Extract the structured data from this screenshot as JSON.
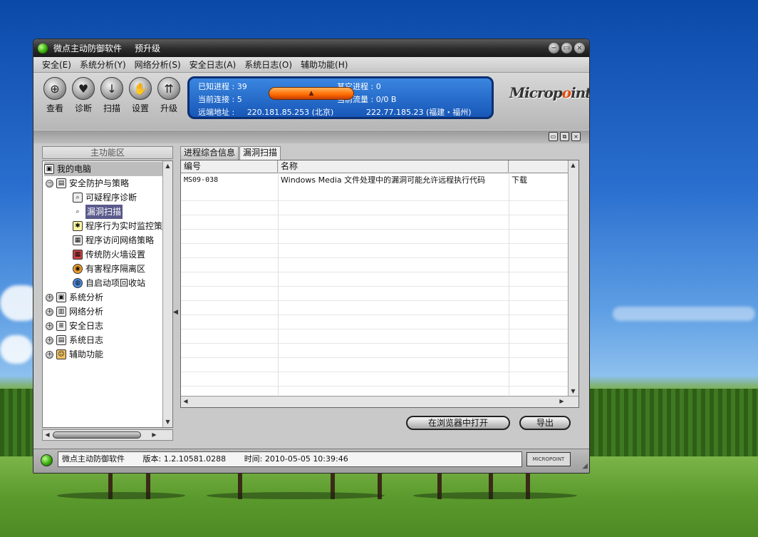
{
  "window": {
    "title": "微点主动防御软件",
    "upgrade": "预升级",
    "buttons": {
      "minimize": "−",
      "restore": "▭",
      "close": "×"
    }
  },
  "menu": [
    "安全(E)",
    "系统分析(Y)",
    "网络分析(S)",
    "安全日志(A)",
    "系统日志(O)",
    "辅助功能(H)"
  ],
  "toolbar": {
    "tools": [
      {
        "label": "查看",
        "icon": "magnifier-icon"
      },
      {
        "label": "诊断",
        "icon": "heart-diagnose-icon"
      },
      {
        "label": "扫描",
        "icon": "scan-icon"
      },
      {
        "label": "设置",
        "icon": "hand-settings-icon"
      },
      {
        "label": "升级",
        "icon": "upgrade-icon"
      }
    ]
  },
  "info": {
    "known_proc_label": "已知进程",
    "known_proc_value": "39",
    "other_proc_label": "其它进程",
    "other_proc_value": "0",
    "conn_label": "当前连接",
    "conn_value": "5",
    "traffic_label": "当前流量",
    "traffic_value": "0/0 B",
    "remote_label": "远端地址",
    "remote_ip1": "220.181.85.253 (北京)",
    "remote_ip2": "222.77.185.23 (福建・福州)"
  },
  "logo": {
    "text_a": "Microp",
    "text_o": "o",
    "text_b": "int"
  },
  "left_pane": {
    "title": "主功能区",
    "root": "我的电脑",
    "group": "安全防护与策略",
    "children": [
      "可疑程序诊断",
      "漏洞扫描",
      "程序行为实时监控策",
      "程序访问网络策略",
      "传统防火墙设置",
      "有害程序隔离区",
      "自启动项回收站"
    ],
    "collapsed": [
      "系统分析",
      "网络分析",
      "安全日志",
      "系统日志",
      "辅助功能"
    ]
  },
  "tabs": [
    "进程综合信息",
    "漏洞扫描"
  ],
  "grid": {
    "columns": [
      "编号",
      "名称",
      ""
    ],
    "rows": [
      {
        "id": "MS09-038",
        "name": "Windows Media 文件处理中的漏洞可能允许远程执行代码",
        "action": "下载"
      }
    ]
  },
  "actions": {
    "open_browser": "在浏览器中打开",
    "export": "导出"
  },
  "status": {
    "app": "微点主动防御软件",
    "version": "版本: 1.2.10581.0288",
    "time": "时间: 2010-05-05 10:39:46",
    "logo": "MICROPOINT"
  },
  "colors": {
    "accent_blue": "#1757b8",
    "orange": "#ff6a00",
    "selected": "#5a5a8c"
  }
}
